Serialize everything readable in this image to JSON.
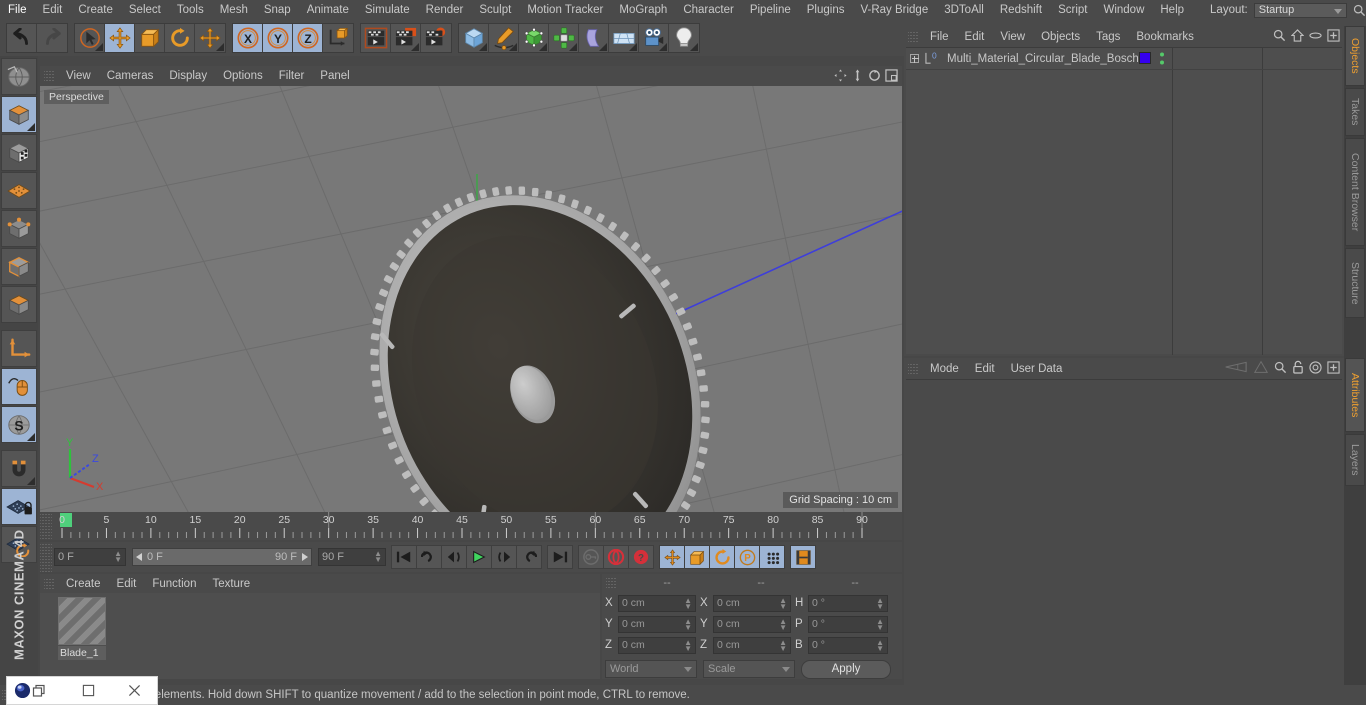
{
  "menubar": {
    "items": [
      "File",
      "Edit",
      "Create",
      "Select",
      "Tools",
      "Mesh",
      "Snap",
      "Animate",
      "Simulate",
      "Render",
      "Sculpt",
      "Motion Tracker",
      "MoGraph",
      "Character",
      "Pipeline",
      "Plugins",
      "V-Ray Bridge",
      "3DToAll",
      "Redshift",
      "Script",
      "Window",
      "Help"
    ],
    "layout_label": "Layout:",
    "layout_value": "Startup",
    "search_icon": "search-icon"
  },
  "toolbar": {
    "groups": [
      {
        "name": "history",
        "buttons": [
          {
            "icon": "undo-icon",
            "label": "Undo",
            "selected": false
          },
          {
            "icon": "redo-icon",
            "label": "Redo",
            "selected": false
          }
        ]
      },
      {
        "name": "transform-tools",
        "buttons": [
          {
            "icon": "select-cursor-icon",
            "label": "Live Selection",
            "selected": false,
            "submenu": true
          },
          {
            "icon": "move-icon",
            "label": "Move",
            "selected": true
          },
          {
            "icon": "scale-icon",
            "label": "Scale",
            "selected": false
          },
          {
            "icon": "rotate-icon",
            "label": "Rotate",
            "selected": false
          },
          {
            "icon": "move-axis-icon",
            "label": "Move Axis",
            "selected": false,
            "submenu": true
          }
        ]
      },
      {
        "name": "axis-locks",
        "buttons": [
          {
            "icon": "x-axis-icon",
            "label": "X Axis",
            "selected": true
          },
          {
            "icon": "y-axis-icon",
            "label": "Y Axis",
            "selected": true
          },
          {
            "icon": "z-axis-icon",
            "label": "Z Axis",
            "selected": true
          },
          {
            "icon": "world-coordinates-icon",
            "label": "World / Object Coordinates",
            "selected": false
          }
        ]
      },
      {
        "name": "render-tools",
        "buttons": [
          {
            "icon": "render-view-icon",
            "label": "Render View",
            "selected": false
          },
          {
            "icon": "render-region-icon",
            "label": "Render to Picture Viewer",
            "selected": false,
            "submenu": true
          },
          {
            "icon": "render-settings-icon",
            "label": "Edit Render Settings",
            "selected": false
          }
        ]
      },
      {
        "name": "create-objects",
        "buttons": [
          {
            "icon": "cube-primitive-icon",
            "label": "Add Cube Object",
            "selected": false,
            "submenu": true
          },
          {
            "icon": "pen-spline-icon",
            "label": "Add Spline",
            "selected": false,
            "submenu": true
          },
          {
            "icon": "nurbs-icon",
            "label": "Add Subdivision Surface",
            "selected": false,
            "submenu": true
          },
          {
            "icon": "array-icon",
            "label": "Add Array Object",
            "selected": false,
            "submenu": true
          },
          {
            "icon": "bend-deformer-icon",
            "label": "Add Bend Object",
            "selected": false,
            "submenu": true
          },
          {
            "icon": "floor-environment-icon",
            "label": "Add Floor Object",
            "selected": false,
            "submenu": true
          },
          {
            "icon": "camera-icon",
            "label": "Add Camera Object",
            "selected": false,
            "submenu": true
          },
          {
            "icon": "light-icon",
            "label": "Add Light Object",
            "selected": false,
            "submenu": true
          }
        ]
      }
    ]
  },
  "left_toolbar": {
    "buttons": [
      {
        "icon": "world-axis-icon",
        "label": "Make Editable / Axis",
        "selected": false
      },
      {
        "icon": "model-mode-icon",
        "label": "Model Mode",
        "selected": true,
        "submenu": true
      },
      {
        "icon": "texture-mode-icon",
        "label": "Texture Mode",
        "selected": false
      },
      {
        "icon": "points-mode-icon",
        "label": "Points Mode",
        "selected": false
      },
      {
        "icon": "edges-mode-icon",
        "label": "Edges Mode",
        "selected": false
      },
      {
        "icon": "polygons-mode-icon",
        "label": "Polygons Mode",
        "selected": false
      },
      {
        "icon": "face-mode-icon",
        "label": "Polygon Face Mode",
        "selected": false
      },
      {
        "icon": "axis-mode-icon",
        "label": "Enable Axis Modification",
        "selected": false
      },
      {
        "icon": "viewport-solo-icon",
        "label": "Viewport Solo Single",
        "selected": true
      },
      {
        "icon": "snap-s-icon",
        "label": "Enable Snapping",
        "selected": true,
        "submenu": true
      },
      {
        "icon": "magnet-icon",
        "label": "Workplane Magnet",
        "selected": false,
        "submenu": true
      },
      {
        "icon": "workplane-lock-icon",
        "label": "Lock Workplane",
        "selected": true
      },
      {
        "icon": "workplane-rotate-icon",
        "label": "Planar Workplane Rotate",
        "selected": false
      }
    ],
    "brand": "MAXON CINEMA 4D"
  },
  "viewport": {
    "menu_items": [
      "View",
      "Cameras",
      "Display",
      "Options",
      "Filter",
      "Panel"
    ],
    "right_icons": [
      "pan-icon",
      "dolly-icon",
      "rotate-view-icon",
      "maximize-viewport-icon"
    ],
    "perspective_label": "Perspective",
    "grid_spacing_label": "Grid Spacing : 10 cm",
    "axis_gizmo": {
      "x": "X",
      "y": "Y",
      "z": "Z",
      "x_color": "#d53b2f",
      "y_color": "#2fc23c",
      "z_color": "#3a49e0"
    },
    "object_name": "Circular Saw Blade"
  },
  "timeline": {
    "ticks": [
      0,
      5,
      10,
      15,
      20,
      25,
      30,
      35,
      40,
      45,
      50,
      55,
      60,
      65,
      70,
      75,
      80,
      85,
      90
    ],
    "current_frame_marker": 0,
    "end_field": "0 F"
  },
  "transport": {
    "current_frame": "0 F",
    "range_start": "0 F",
    "range_end": "90 F",
    "max_frame": "90 F",
    "playback_buttons": [
      {
        "icon": "go-to-start-icon",
        "label": "Go to Start"
      },
      {
        "icon": "previous-key-icon",
        "label": "Go to Previous Key"
      },
      {
        "icon": "previous-frame-icon",
        "label": "Go to Previous Frame"
      },
      {
        "icon": "play-icon",
        "label": "Play Forwards"
      },
      {
        "icon": "next-frame-icon",
        "label": "Go to Next Frame"
      },
      {
        "icon": "next-key-icon",
        "label": "Go to Next Key"
      },
      {
        "icon": "go-to-end-icon",
        "label": "Go to End"
      }
    ],
    "record_buttons": [
      {
        "icon": "autokey-icon",
        "label": "Autokeying",
        "selected": false
      },
      {
        "icon": "record-icon",
        "label": "Record Active Objects",
        "selected": false
      },
      {
        "icon": "keyframe-selection-icon",
        "label": "Keyframe Selection",
        "selected": false
      }
    ],
    "key_toggles": [
      {
        "icon": "key-position-icon",
        "label": "Position"
      },
      {
        "icon": "key-scale-icon",
        "label": "Scale"
      },
      {
        "icon": "key-rotation-icon",
        "label": "Rotation"
      },
      {
        "icon": "key-param-icon",
        "label": "Parameter"
      },
      {
        "icon": "key-pla-icon",
        "label": "Point Level Animation"
      }
    ],
    "timeline_toggle": {
      "icon": "timeline-icon",
      "label": "Animate Mode"
    }
  },
  "material_manager": {
    "menu_items": [
      "Create",
      "Edit",
      "Function",
      "Texture"
    ],
    "materials": [
      {
        "name": "Blade_1",
        "selected": true
      }
    ]
  },
  "coordinates": {
    "header": [
      "--",
      "--",
      "--"
    ],
    "rows": [
      {
        "pos_label": "X",
        "pos_value": "0 cm",
        "size_label": "X",
        "size_value": "0 cm",
        "rot_label": "H",
        "rot_value": "0 °"
      },
      {
        "pos_label": "Y",
        "pos_value": "0 cm",
        "size_label": "Y",
        "size_value": "0 cm",
        "rot_label": "P",
        "rot_value": "0 °"
      },
      {
        "pos_label": "Z",
        "pos_value": "0 cm",
        "size_label": "Z",
        "size_value": "0 cm",
        "rot_label": "B",
        "rot_value": "0 °"
      }
    ],
    "coord_system": "World",
    "mode": "Scale",
    "apply_label": "Apply"
  },
  "object_manager": {
    "menu_items": [
      "File",
      "Edit",
      "View",
      "Objects",
      "Tags",
      "Bookmarks"
    ],
    "right_icons": [
      "search-icon",
      "home-icon",
      "ellipse-icon",
      "plus-box-icon"
    ],
    "objects": [
      {
        "name": "Multi_Material_Circular_Blade_Bosch",
        "tag_color": "#3500ee",
        "expandable": true,
        "layer": "0"
      }
    ]
  },
  "attributes_manager": {
    "menu_items": [
      "Mode",
      "Edit",
      "User Data"
    ],
    "right_icons": [
      "back-arrow-icon",
      "forward-arrow-icon",
      "search-icon",
      "lock-icon",
      "target-icon",
      "plus-box-icon"
    ]
  },
  "right_tabs": {
    "top": [
      {
        "label": "Objects",
        "active": true
      },
      {
        "label": "Takes",
        "active": false
      },
      {
        "label": "Content Browser",
        "active": false
      },
      {
        "label": "Structure",
        "active": false
      }
    ],
    "bottom": [
      {
        "label": "Attributes",
        "active": true
      },
      {
        "label": "Layers",
        "active": false
      }
    ]
  },
  "status_bar": {
    "text": "Click and drag to move elements. Hold down SHIFT to quantize movement / add to the selection in point mode, CTRL to remove."
  },
  "popup_window": {
    "app_icon": "app-icon",
    "restore_icon": "restore-window-icon",
    "maximize_icon": "maximize-window-icon",
    "close_icon": "close-window-icon"
  },
  "colors": {
    "panel_bg": "#4a4a4a",
    "viewport_bg": "#787878",
    "accent_orange": "#f0a030",
    "selected_blue": "#9db4d4",
    "tag_blue": "#3500ee"
  }
}
